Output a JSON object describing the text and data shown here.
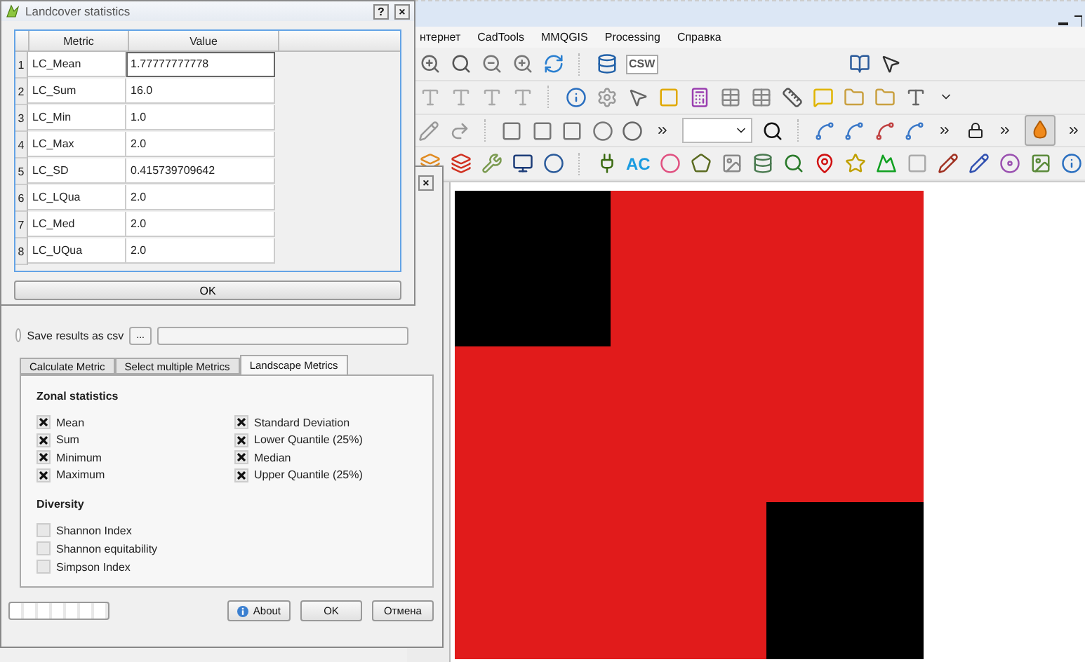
{
  "stats_window": {
    "title": "Landcover statistics",
    "help": "?",
    "close": "×",
    "columns": [
      "Metric",
      "Value"
    ],
    "rows": [
      {
        "index": "1",
        "metric": "LC_Mean",
        "value": "1.77777777778",
        "selected": true
      },
      {
        "index": "2",
        "metric": "LC_Sum",
        "value": "16.0",
        "selected": false
      },
      {
        "index": "3",
        "metric": "LC_Min",
        "value": "1.0",
        "selected": false
      },
      {
        "index": "4",
        "metric": "LC_Max",
        "value": "2.0",
        "selected": false
      },
      {
        "index": "5",
        "metric": "LC_SD",
        "value": "0.415739709642",
        "selected": false
      },
      {
        "index": "6",
        "metric": "LC_LQua",
        "value": "2.0",
        "selected": false
      },
      {
        "index": "7",
        "metric": "LC_Med",
        "value": "2.0",
        "selected": false
      },
      {
        "index": "8",
        "metric": "LC_UQua",
        "value": "2.0",
        "selected": false
      }
    ],
    "ok": "OK"
  },
  "main_window": {
    "menu": [
      "нтернет",
      "CadTools",
      "MMQGIS",
      "Processing",
      "Справка"
    ],
    "csw_label": "CSW",
    "ac_label": "AC"
  },
  "plugin_dialog": {
    "close": "×",
    "save_csv": {
      "label": "Save results as csv",
      "selected": false,
      "browse": "..."
    },
    "tabs": [
      {
        "label": "Calculate Metric",
        "selected": false
      },
      {
        "label": "Select multiple Metrics",
        "selected": false
      },
      {
        "label": "Landscape Metrics",
        "selected": true
      }
    ],
    "progress": {
      "level": 0
    },
    "sections": [
      {
        "title": "Zonal statistics",
        "kind": "grid",
        "items": [
          {
            "label": "Mean",
            "checked": true
          },
          {
            "label": "Sum",
            "checked": true
          },
          {
            "label": "Minimum",
            "checked": true
          },
          {
            "label": "Maximum",
            "checked": true
          },
          {
            "label": "Standard Deviation",
            "checked": true
          },
          {
            "label": "Lower Quantile (25%)",
            "checked": true
          },
          {
            "label": "Median",
            "checked": true
          },
          {
            "label": "Upper Quantile (25%)",
            "checked": true
          }
        ]
      },
      {
        "title": "Diversity",
        "kind": "list",
        "items": [
          {
            "label": "Shannon Index",
            "checked": false
          },
          {
            "label": "Shannon equitability",
            "checked": false
          },
          {
            "label": "Simpson Index",
            "checked": false
          }
        ]
      }
    ],
    "buttons": [
      {
        "label": "About",
        "kind": "info"
      },
      {
        "label": "OK",
        "kind": "plain"
      },
      {
        "label": "Отмена",
        "kind": "plain"
      }
    ]
  }
}
